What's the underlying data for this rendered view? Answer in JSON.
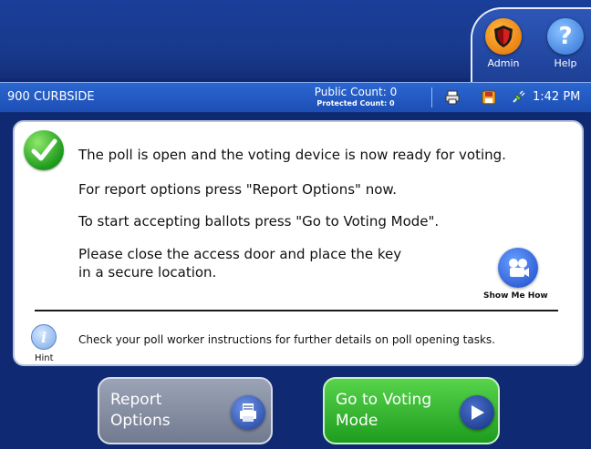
{
  "header": {
    "admin_label": "Admin",
    "help_label": "Help"
  },
  "status_bar": {
    "precinct": "900 CURBSIDE",
    "public_count": "Public Count: 0",
    "protected_count": "Protected Count: 0",
    "time": "1:42 PM"
  },
  "message": {
    "line1": "The poll is open and the voting device is now ready for voting.",
    "line2": "For report options press \"Report Options\" now.",
    "line3": "To start accepting ballots press \"Go to Voting Mode\".",
    "line4a": "Please close the access door and place the key",
    "line4b": "in a secure location.",
    "show_me_how": "Show Me How"
  },
  "hint": {
    "label": "Hint",
    "text": "Check your poll worker instructions for further details on poll opening tasks."
  },
  "buttons": {
    "report_line1": "Report",
    "report_line2": "Options",
    "voting_line1": "Go to Voting",
    "voting_line2": "Mode"
  },
  "colors": {
    "background": "#0f2a72",
    "status_bar": "#2b66d0",
    "accept": "#2fb52a",
    "admin": "#f08a10",
    "help": "#4a8be8"
  }
}
